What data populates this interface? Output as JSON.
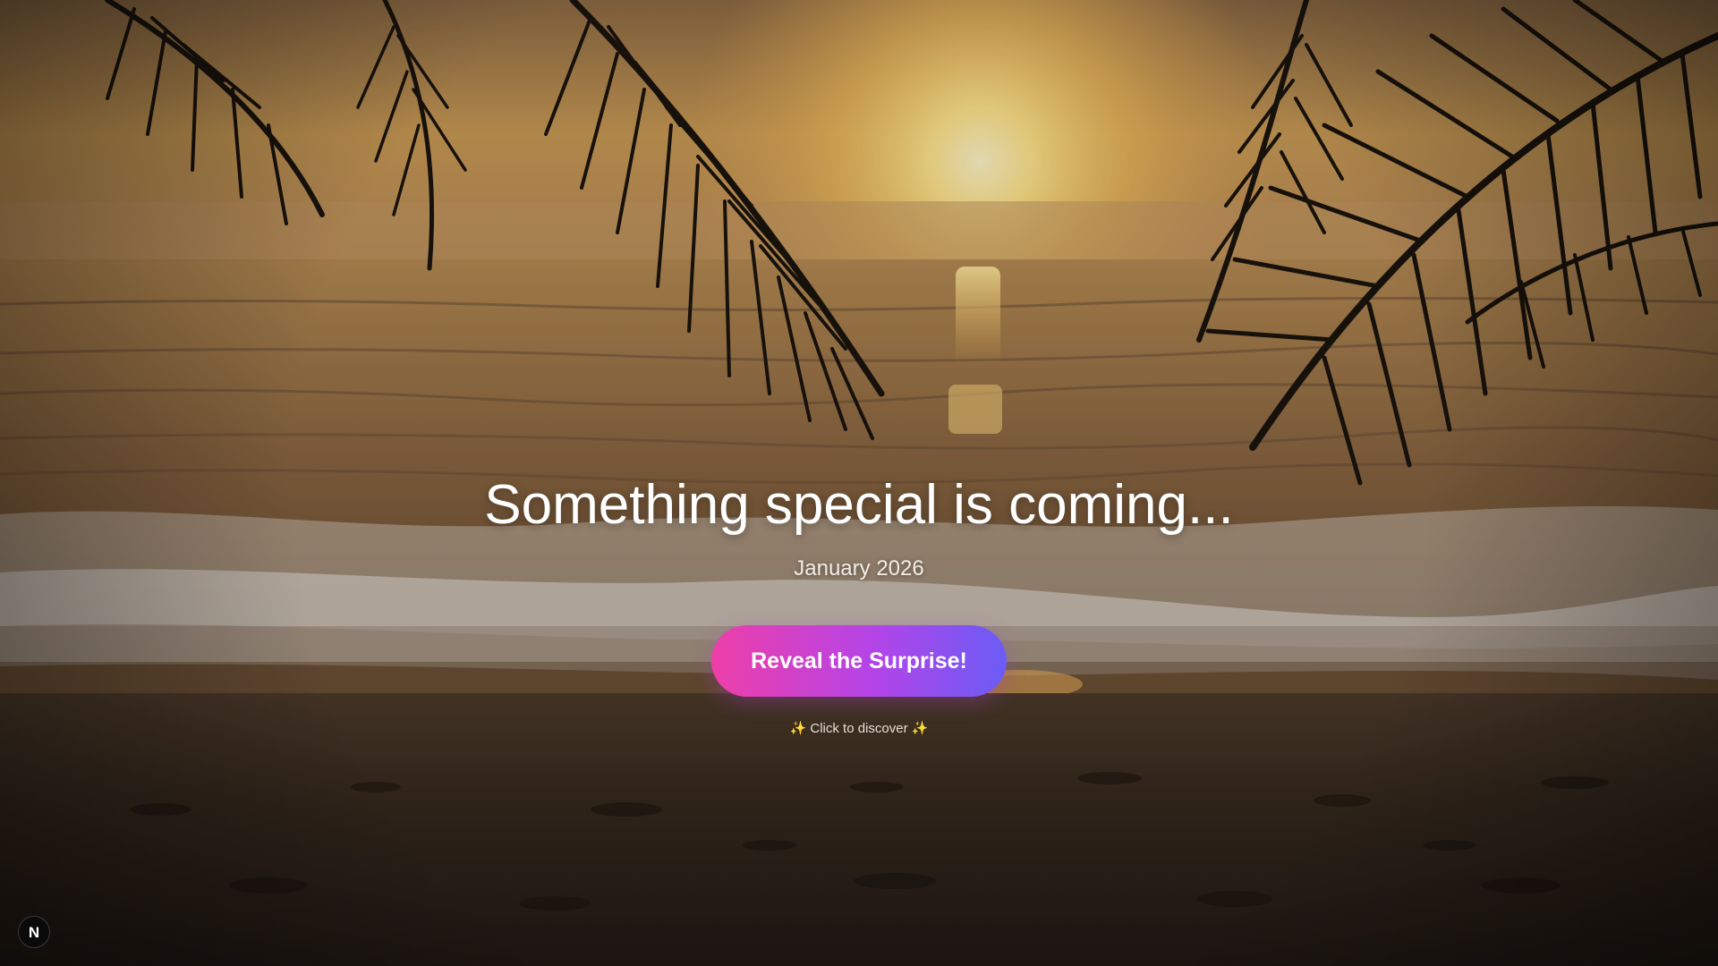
{
  "hero": {
    "headline": "Something special is coming...",
    "date": "January 2026",
    "cta_label": "Reveal the Surprise!",
    "hint_prefix": "✨",
    "hint_text": "Click to discover",
    "hint_suffix": "✨"
  },
  "dev_badge": {
    "label": "N",
    "icon": "nextjs-logo-icon"
  },
  "colors": {
    "cta_gradient_start": "#ee3fa8",
    "cta_gradient_end": "#6a5cf5",
    "text": "#ffffff",
    "sparkle": "#ffd84a"
  }
}
